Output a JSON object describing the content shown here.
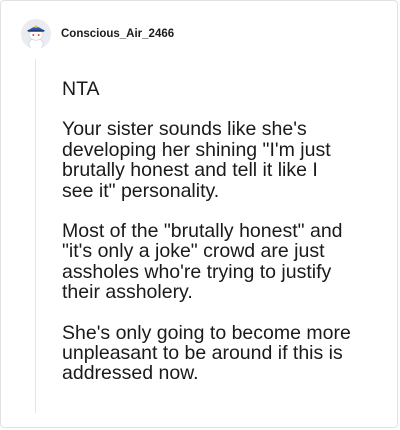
{
  "comment": {
    "author": "Conscious_Air_2466",
    "avatar_icon": "reddit-snoo-avatar-icon",
    "paragraphs": [
      "NTA",
      "Your sister sounds like she's\ndeveloping her shining \"I'm just\nbrutally honest and tell it like I\nsee it\" personality.",
      "Most of the \"brutally honest\" and\n\"it's only a joke\" crowd are just\nassholes who're trying to justify\ntheir assholery.",
      "She's only going to become more\nunpleasant to be around if this is\naddressed now."
    ]
  },
  "colors": {
    "text": "#1a1a1b",
    "thread_line": "#e4e4e4",
    "avatar_bg": "#e9ecf1",
    "avatar_hat": "#2f5cad"
  }
}
